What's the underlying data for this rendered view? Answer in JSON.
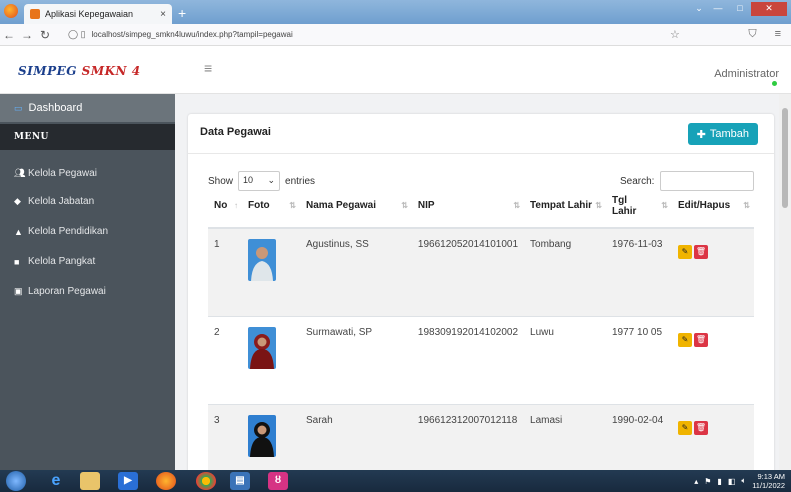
{
  "browser": {
    "tab_title": "Aplikasi Kepegawaian",
    "tab_close": "×",
    "new_tab": "+",
    "url": "localhost/simpeg_smkn4luwu/index.php?tampil=pegawai",
    "window_controls": [
      "—",
      "□",
      "✕"
    ]
  },
  "header": {
    "logo_part1": "SIMPEG",
    "logo_part2": "SMKN 4",
    "user": "Administrator"
  },
  "sidebar": {
    "dashboard": "Dashboard",
    "menu_heading": "MENU",
    "items": [
      {
        "label": "Kelola Pegawai",
        "icon": "users-icon"
      },
      {
        "label": "Kelola Jabatan",
        "icon": "tag-icon"
      },
      {
        "label": "Kelola Pendidikan",
        "icon": "graduation-cap-icon"
      },
      {
        "label": "Kelola Pangkat",
        "icon": "bookmark-icon"
      },
      {
        "label": "Laporan Pegawai",
        "icon": "report-icon"
      }
    ]
  },
  "main": {
    "card_title": "Data Pegawai",
    "add_button": "Tambah",
    "show_label": "Show",
    "show_value": "10",
    "entries_label": "entries",
    "search_label": "Search:",
    "columns": [
      "No",
      "Foto",
      "Nama Pegawai",
      "NIP",
      "Tempat Lahir",
      "Tgl Lahir",
      "Edit/Hapus"
    ],
    "rows": [
      {
        "no": "1",
        "nama": "Agustinus, SS",
        "nip": "196612052014101001",
        "tempat": "Tombang",
        "tgl": "1976-11-03"
      },
      {
        "no": "2",
        "nama": "Surmawati, SP",
        "nip": "198309192014102002",
        "tempat": "Luwu",
        "tgl": "1977 10 05"
      },
      {
        "no": "3",
        "nama": "Sarah",
        "nip": "196612312007012118",
        "tempat": "Lamasi",
        "tgl": "1990-02-04"
      }
    ]
  },
  "taskbar": {
    "time": "9:13 AM",
    "date": "11/1/2022"
  },
  "colors": {
    "sidebar_bg": "#4b545c",
    "menu_heading_bg": "#262a2f",
    "tambah_button": "#17a2b8",
    "edit_button": "#f0b400",
    "delete_button": "#dc3545"
  }
}
